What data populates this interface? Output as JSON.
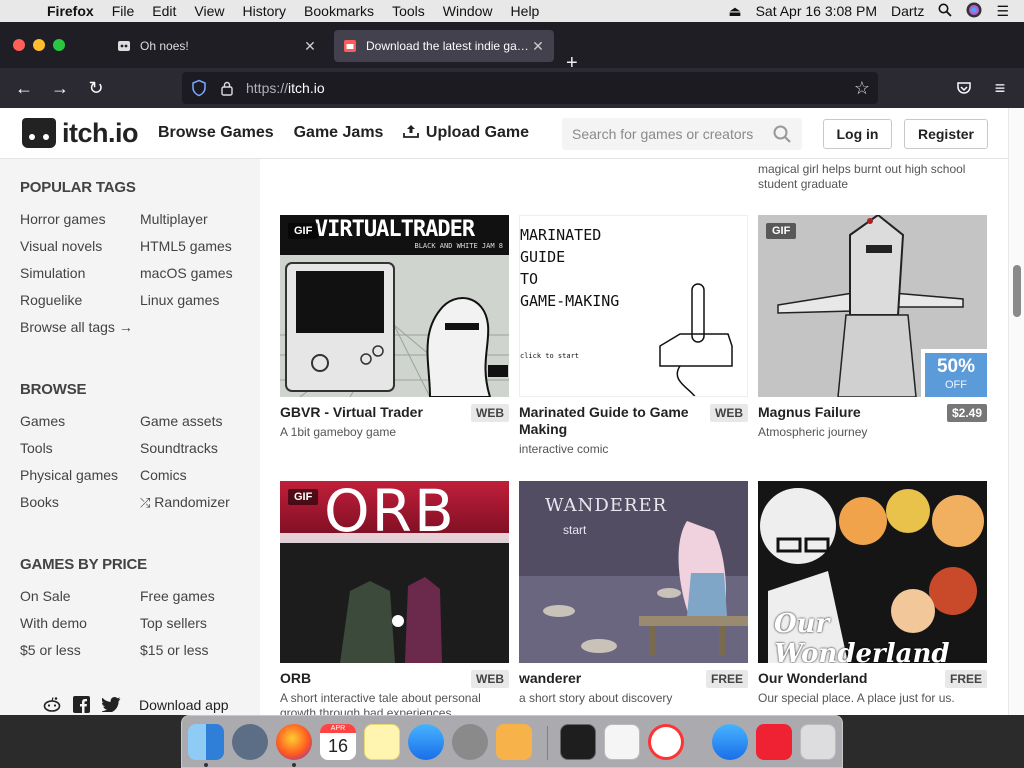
{
  "menubar": {
    "app_name": "Firefox",
    "items": [
      "File",
      "Edit",
      "View",
      "History",
      "Bookmarks",
      "Tools",
      "Window",
      "Help"
    ],
    "clock": "Sat Apr 16  3:08 PM",
    "user": "Dartz"
  },
  "browser": {
    "tabs": [
      {
        "title": "Oh noes!",
        "active": false
      },
      {
        "title": "Download the latest indie games",
        "active": true
      }
    ],
    "url_scheme": "https://",
    "url_host": "itch.io"
  },
  "site": {
    "logo_text": "itch.io",
    "nav": {
      "browse": "Browse Games",
      "jams": "Game Jams",
      "upload": "Upload Game"
    },
    "search_placeholder": "Search for games or creators",
    "login_label": "Log in",
    "register_label": "Register"
  },
  "sidebar": {
    "popular_tags": {
      "heading": "POPULAR TAGS",
      "col1": [
        "Horror games",
        "Visual novels",
        "Simulation",
        "Roguelike",
        "Browse all tags →"
      ],
      "col2": [
        "Multiplayer",
        "HTML5 games",
        "macOS games",
        "Linux games"
      ]
    },
    "browse": {
      "heading": "BROWSE",
      "col1": [
        "Games",
        "Tools",
        "Physical games",
        "Books"
      ],
      "col2": [
        "Game assets",
        "Soundtracks",
        "Comics",
        "Randomizer"
      ]
    },
    "price": {
      "heading": "GAMES BY PRICE",
      "col1": [
        "On Sale",
        "With demo",
        "$5 or less"
      ],
      "col2": [
        "Free games",
        "Top sellers",
        "$15 or less"
      ]
    },
    "download_app": "Download app"
  },
  "content": {
    "prev_desc": "magical girl helps burnt out high school student graduate",
    "games": [
      {
        "title": "GBVR - Virtual Trader",
        "desc": "A 1bit gameboy game",
        "badge": "WEB",
        "gif": "GIF",
        "art_text": "VIRTUALTRADER",
        "art_sub": "BLACK AND WHITE JAM 8"
      },
      {
        "title": "Marinated Guide to Game Making",
        "desc": "interactive comic",
        "badge": "WEB",
        "art_text": "MARINATED\nGUIDE\nTO\nGAME-MAKING",
        "art_sub": "click to start"
      },
      {
        "title": "Magnus Failure",
        "desc": "Atmospheric journey",
        "badge": "$2.49",
        "gif": "GIF",
        "sale_pct": "50%",
        "sale_off": "OFF"
      },
      {
        "title": "ORB",
        "desc": "A short interactive tale about personal growth through bad experiences",
        "badge": "WEB",
        "gif": "GIF",
        "art_text": "ORB"
      },
      {
        "title": "wanderer",
        "desc": "a short story about discovery",
        "badge": "FREE",
        "art_text": "WANDERER",
        "art_sub": "start"
      },
      {
        "title": "Our Wonderland",
        "desc": "Our special place. A place just for us.",
        "badge": "FREE",
        "art_text": "Our Wonderland"
      }
    ]
  },
  "dock": {
    "calendar_month": "APR",
    "calendar_day": "16"
  }
}
